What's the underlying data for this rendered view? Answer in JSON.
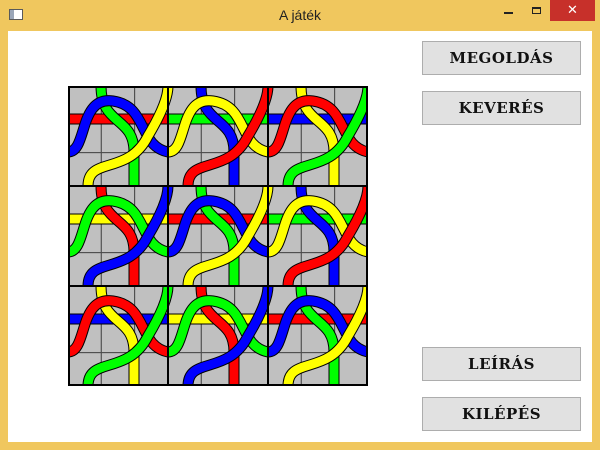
{
  "window": {
    "title": "A játék"
  },
  "buttons": {
    "solve": "MEGOLDÁS",
    "shuffle": "KEVERÉS",
    "description": "LEÍRÁS",
    "exit": "KILÉPÉS"
  },
  "colors": {
    "frame": "#f0c75e",
    "close": "#c7302a",
    "tile": "#c0c0c0",
    "red": "#ff0000",
    "green": "#00ff00",
    "blue": "#0000ff",
    "yellow": "#ffff00"
  },
  "board": {
    "rows": 3,
    "cols": 3,
    "strand_colors": [
      "red",
      "green",
      "blue",
      "yellow"
    ]
  }
}
